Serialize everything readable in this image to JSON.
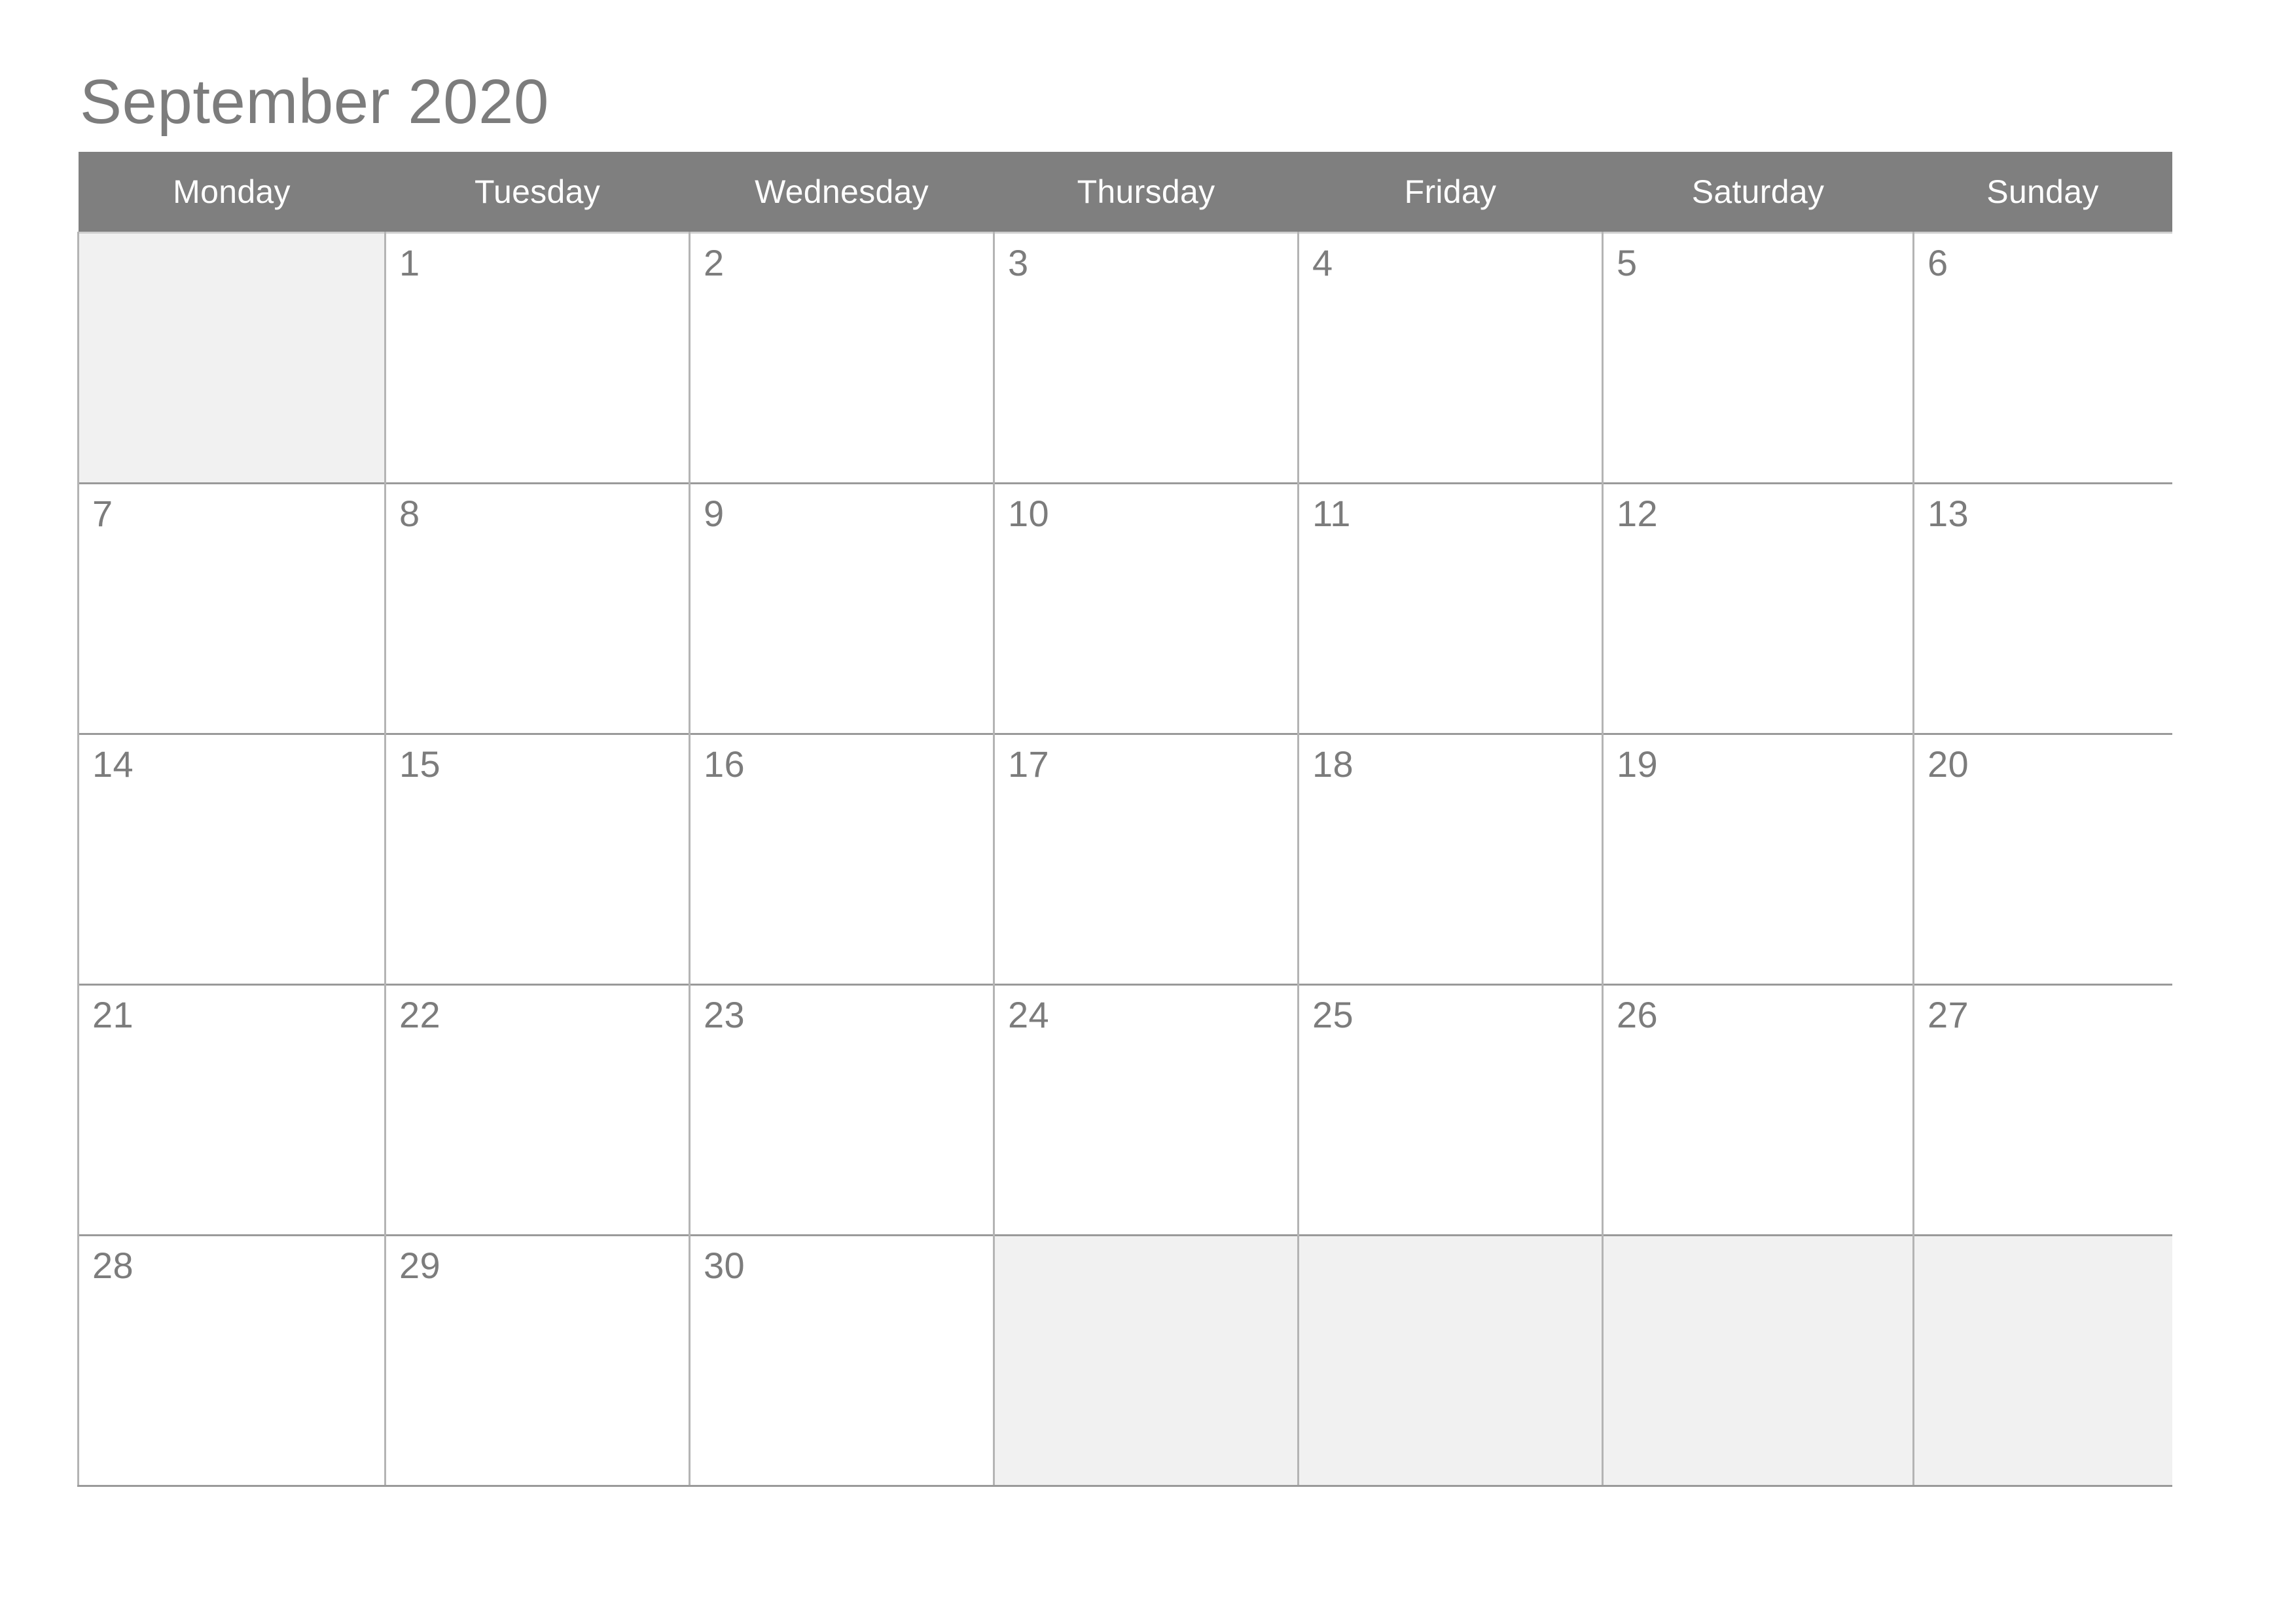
{
  "document": {
    "type": "monthly-calendar",
    "title": "September 2020",
    "month": "September",
    "year": "2020",
    "week_start": "Monday"
  },
  "colors": {
    "header_background": "#7f7f7f",
    "header_text": "#ffffff",
    "day_number_text": "#7c7c7c",
    "title_text": "#7c7c7c",
    "cell_background": "#ffffff",
    "blank_cell_background": "#f1f1f1",
    "grid_line": "#b4b4b4",
    "row_line": "#9a9a9a"
  },
  "weekday_headers": [
    "Monday",
    "Tuesday",
    "Wednesday",
    "Thursday",
    "Friday",
    "Saturday",
    "Sunday"
  ],
  "weeks": [
    [
      {
        "day": "",
        "blank": true
      },
      {
        "day": "1",
        "blank": false
      },
      {
        "day": "2",
        "blank": false
      },
      {
        "day": "3",
        "blank": false
      },
      {
        "day": "4",
        "blank": false
      },
      {
        "day": "5",
        "blank": false
      },
      {
        "day": "6",
        "blank": false
      }
    ],
    [
      {
        "day": "7",
        "blank": false
      },
      {
        "day": "8",
        "blank": false
      },
      {
        "day": "9",
        "blank": false
      },
      {
        "day": "10",
        "blank": false
      },
      {
        "day": "11",
        "blank": false
      },
      {
        "day": "12",
        "blank": false
      },
      {
        "day": "13",
        "blank": false
      }
    ],
    [
      {
        "day": "14",
        "blank": false
      },
      {
        "day": "15",
        "blank": false
      },
      {
        "day": "16",
        "blank": false
      },
      {
        "day": "17",
        "blank": false
      },
      {
        "day": "18",
        "blank": false
      },
      {
        "day": "19",
        "blank": false
      },
      {
        "day": "20",
        "blank": false
      }
    ],
    [
      {
        "day": "21",
        "blank": false
      },
      {
        "day": "22",
        "blank": false
      },
      {
        "day": "23",
        "blank": false
      },
      {
        "day": "24",
        "blank": false
      },
      {
        "day": "25",
        "blank": false
      },
      {
        "day": "26",
        "blank": false
      },
      {
        "day": "27",
        "blank": false
      }
    ],
    [
      {
        "day": "28",
        "blank": false
      },
      {
        "day": "29",
        "blank": false
      },
      {
        "day": "30",
        "blank": false
      },
      {
        "day": "",
        "blank": true
      },
      {
        "day": "",
        "blank": true
      },
      {
        "day": "",
        "blank": true
      },
      {
        "day": "",
        "blank": true
      }
    ]
  ]
}
